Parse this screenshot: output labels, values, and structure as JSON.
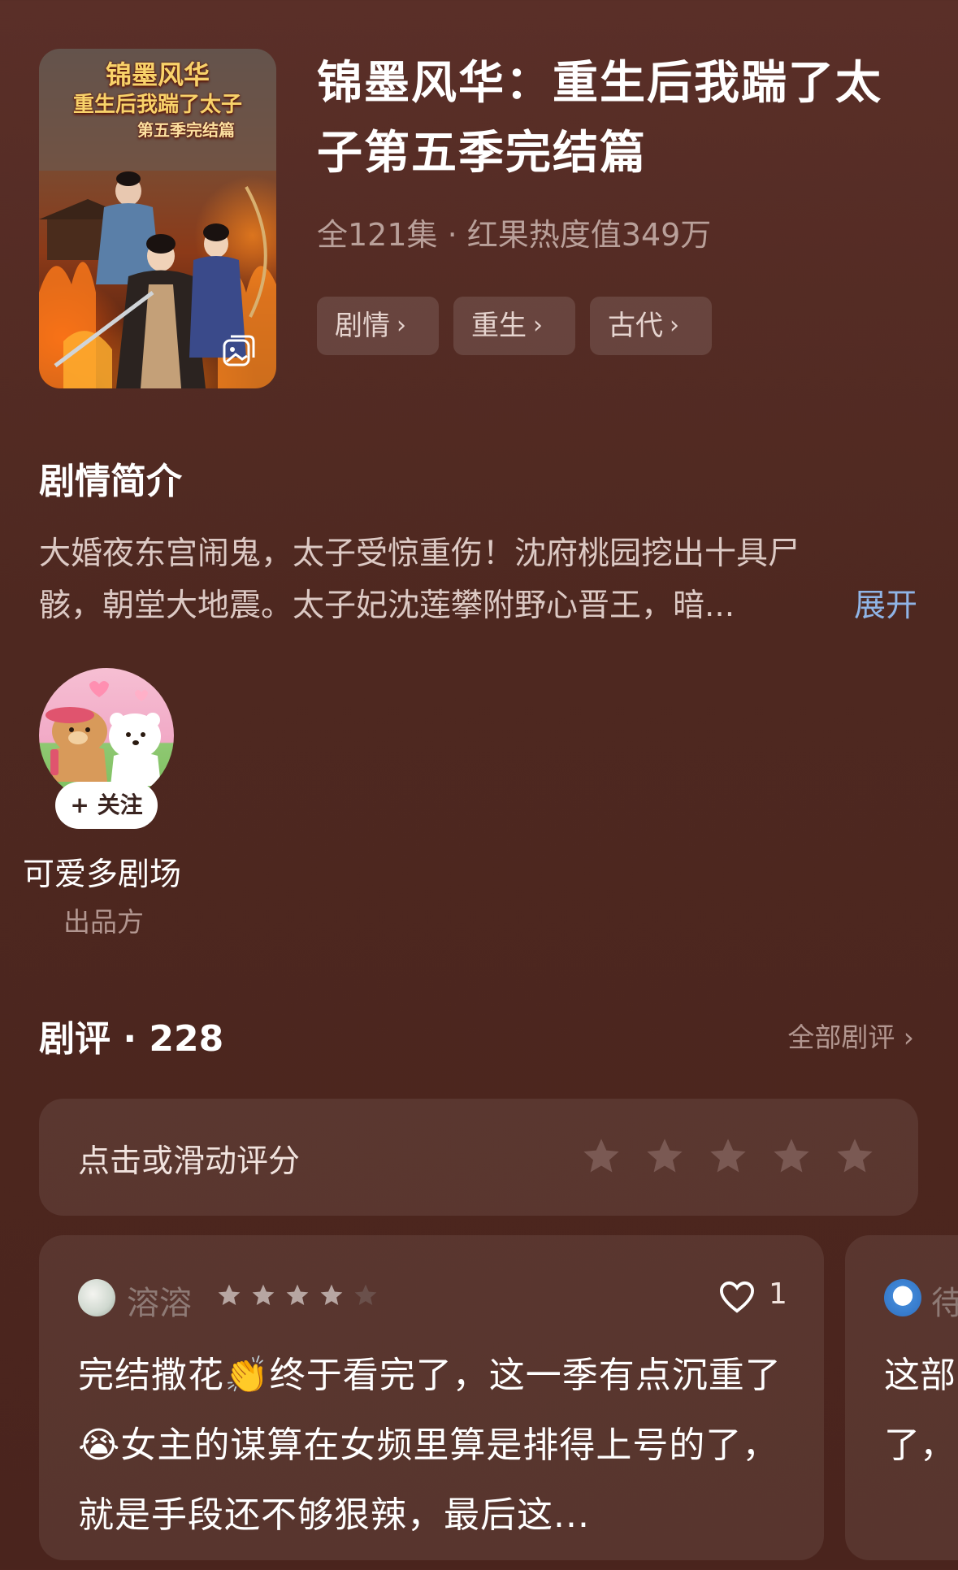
{
  "drama": {
    "cover_title_line1": "锦墨风华",
    "cover_title_line2": "重生后我踹了太子",
    "cover_title_line3": "第五季完结篇",
    "title": "锦墨风华：重生后我踹了太子第五季完结篇",
    "meta": "全121集 · 红果热度值349万",
    "tags": [
      {
        "label": "剧情"
      },
      {
        "label": "重生"
      },
      {
        "label": "古代"
      }
    ]
  },
  "synopsis": {
    "heading": "剧情简介",
    "text": "大婚夜东宫闹鬼，太子受惊重伤！沈府桃园挖出十具尸骸，朝堂大地震。太子妃沈莲攀附野心晋王，暗...",
    "expand_label": "展开"
  },
  "producer": {
    "follow_label": "+ 关注",
    "name": "可爱多剧场",
    "role": "出品方"
  },
  "reviews": {
    "heading": "剧评 · 228",
    "all_label": "全部剧评 ›",
    "rating_prompt": "点击或滑动评分",
    "items": [
      {
        "user": "溶溶",
        "stars": 4,
        "likes": "1",
        "text": "完结撒花👏终于看完了，这一季有点沉重了😭女主的谋算在女频里算是排得上号的了，就是手段还不够狠辣，最后这..."
      },
      {
        "user": "待",
        "text": "这部\n了，"
      }
    ]
  },
  "colors": {
    "background": "#4e2820",
    "accent_link": "#8fb4e6",
    "card": "rgba(255,255,255,0.08)"
  },
  "icons": {
    "gallery": "gallery-icon",
    "chevron": "chevron-right-icon",
    "star": "star-icon",
    "heart": "heart-icon"
  }
}
